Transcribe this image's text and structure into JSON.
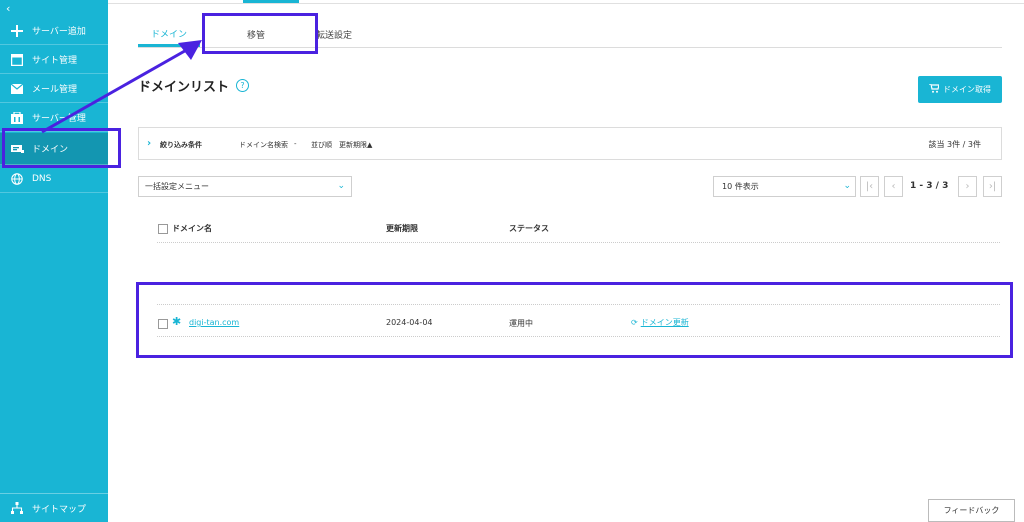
{
  "sidebar": {
    "collapse_glyph": "‹",
    "items": [
      {
        "label": "サーバー追加",
        "icon": "plus-icon"
      },
      {
        "label": "サイト管理",
        "icon": "window-icon"
      },
      {
        "label": "メール管理",
        "icon": "mail-icon"
      },
      {
        "label": "サーバー管理",
        "icon": "server-icon"
      },
      {
        "label": "ドメイン",
        "icon": "domain-icon",
        "active": true
      },
      {
        "label": "DNS",
        "icon": "globe-icon"
      }
    ],
    "sitemap_label": "サイトマップ"
  },
  "tabs": [
    {
      "label": "ドメイン",
      "active": true
    },
    {
      "label": "移管"
    },
    {
      "label": "転送設定"
    }
  ],
  "page": {
    "title": "ドメインリスト",
    "help_glyph": "?",
    "get_domain_label": "ドメイン取得"
  },
  "filter": {
    "toggle_label": "絞り込み条件",
    "search_label": "ドメイン名検索",
    "search_value": "-",
    "sort_label": "並び順",
    "sort_value": "更新期限▲",
    "result_count": "該当 3件 / 3件"
  },
  "controls": {
    "bulk_menu": "一括設定メニュー",
    "per_page": "10 件表示",
    "page_range": "1 - 3 / 3"
  },
  "table": {
    "headers": [
      "ドメイン名",
      "更新期限",
      "ステータス"
    ],
    "rows": [
      {
        "domain": "digi-tan.com",
        "expiry": "2024-04-04",
        "status": "運用中",
        "action": "ドメイン更新"
      }
    ]
  },
  "feedback_label": "フィードバック",
  "colors": {
    "accent": "#19b5d4",
    "annotation": "#4a22e0"
  }
}
